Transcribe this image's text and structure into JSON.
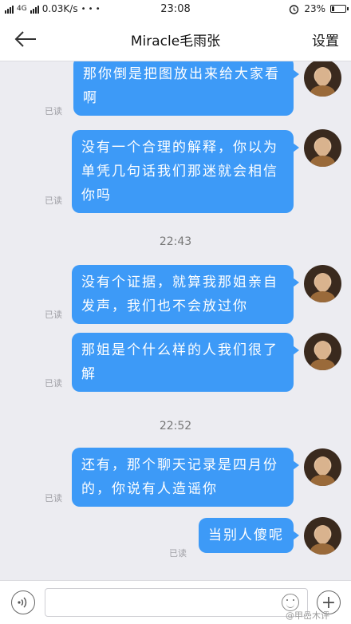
{
  "status_bar": {
    "network": "4G",
    "speed": "0.03K/s",
    "more": "• • •",
    "time": "23:08",
    "battery": "23%",
    "battery_level": 0.23
  },
  "header": {
    "title": "Miracle毛雨张",
    "settings_label": "设置",
    "back_icon": "arrow-left-icon"
  },
  "messages": [
    {
      "text_lines": [
        "那你倒是把图放出来给大家看",
        "啊"
      ],
      "read": "已读"
    },
    {
      "text_lines": [
        "没有一个合理的解释，你以为",
        "单凭几句话我们那迷就会相信",
        "你吗"
      ],
      "read": "已读"
    },
    {
      "separator": "22:43"
    },
    {
      "text_lines": [
        "没有个证据，就算我那姐亲自",
        "发声，我们也不会放过你"
      ],
      "read": "已读"
    },
    {
      "text_lines": [
        "那姐是个什么样的人我们很了",
        "解"
      ],
      "read": "已读"
    },
    {
      "separator": "22:52"
    },
    {
      "text_lines": [
        "还有，那个聊天记录是四月份",
        "的，你说有人造谣你"
      ],
      "read": "已读"
    },
    {
      "text_lines": [
        "当别人傻呢"
      ],
      "read": "已读"
    }
  ],
  "input_bar": {
    "value": "",
    "voice_icon": "voice-icon",
    "emoji_icon": "emoji-icon",
    "plus_icon": "plus-icon"
  },
  "watermark": "@甲嵒木评",
  "colors": {
    "bubble": "#3d9af7",
    "background": "#ececf1"
  }
}
